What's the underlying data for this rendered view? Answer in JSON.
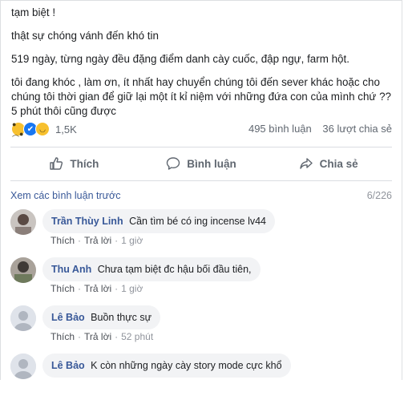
{
  "post": {
    "paragraphs": [
      "tạm biệt !",
      "thật sự chóng vánh đến khó tin",
      "519 ngày, từng ngày đều đặng điểm danh cày cuốc, đập ngự, farm hột.",
      "tôi đang khóc , làm ơn, ít nhất hay chuyển chúng tôi đến sever khác hoặc cho chúng tôi thời gian để giữ lại một ít kỉ niệm với những đứa con của mình chứ ?? 5 phút thôi cũng được"
    ]
  },
  "reactions": {
    "count": "1,5K",
    "icons": [
      "sad-icon",
      "like-icon",
      "haha-icon"
    ]
  },
  "stats": {
    "comments": "495 bình luận",
    "shares": "36 lượt chia sẻ"
  },
  "actions": {
    "like": "Thích",
    "comment": "Bình luận",
    "share": "Chia sẻ"
  },
  "comments_header": {
    "view_previous": "Xem các bình luận trước",
    "pager": "6/226"
  },
  "comments": [
    {
      "author": "Trần Thùy Linh",
      "text": "Cần tìm bé có ing incense lv44",
      "like": "Thích",
      "reply": "Trả lời",
      "time": "1 giờ"
    },
    {
      "author": "Thu Anh",
      "text": "Chưa tạm biệt đc hậu bối đầu tiên,",
      "like": "Thích",
      "reply": "Trả lời",
      "time": "1 giờ"
    },
    {
      "author": "Lê Bảo",
      "text": "Buồn thực sự",
      "like": "Thích",
      "reply": "Trả lời",
      "time": "52 phút"
    },
    {
      "author": "Lê Bảo",
      "text": "K còn những ngày cày story mode cực khổ",
      "like": "",
      "reply": "",
      "time": ""
    }
  ]
}
